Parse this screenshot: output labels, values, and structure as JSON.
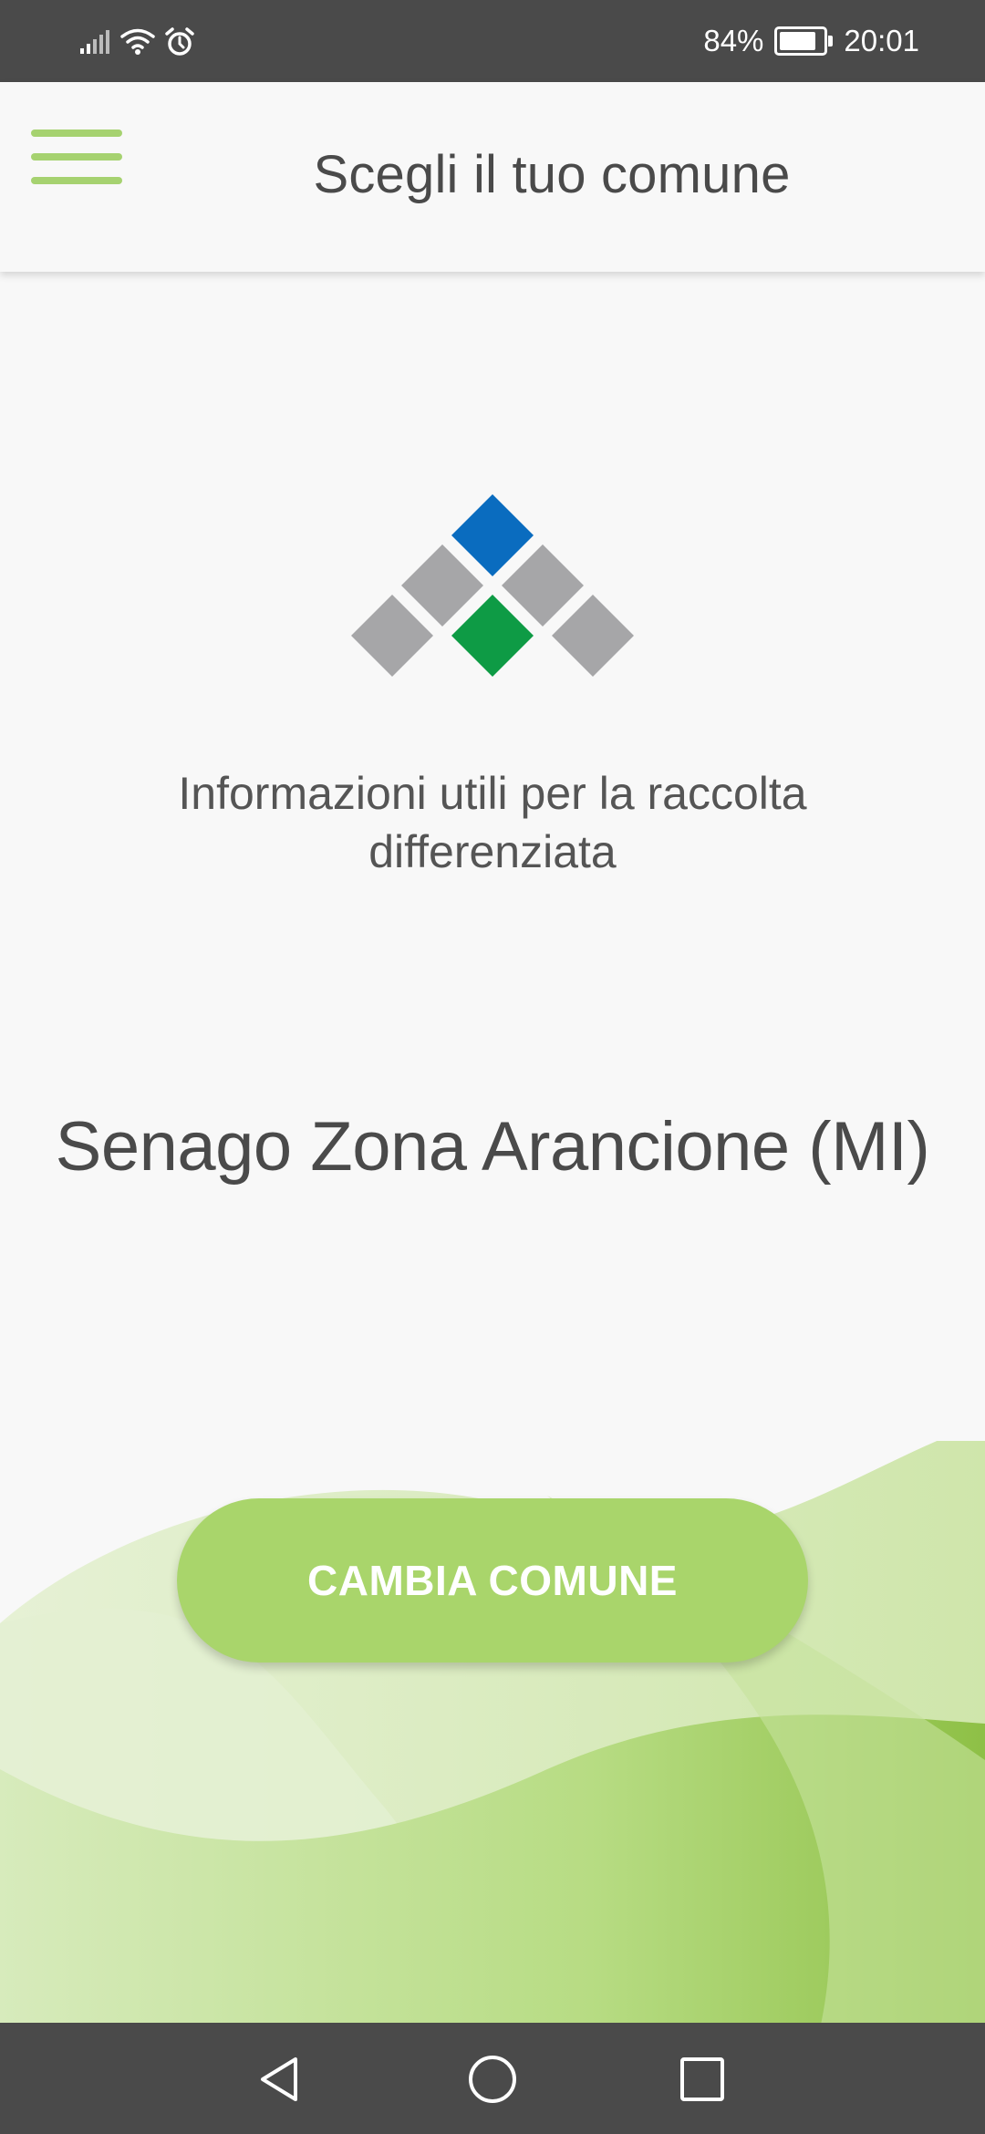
{
  "status_bar": {
    "battery_percent": "84%",
    "battery_level": 0.84,
    "time": "20:01",
    "icons": [
      "signal-icon",
      "wifi-icon",
      "alarm-icon",
      "battery-icon"
    ]
  },
  "app_bar": {
    "menu_icon": "menu-icon",
    "title": "Scegli il tuo comune"
  },
  "main": {
    "logo": "app-logo",
    "subtitle": "Informazioni utili per la raccolta differenziata",
    "comune_name": "Senago Zona Arancione (MI)",
    "change_button_label": "CAMBIA COMUNE"
  },
  "nav_bar": {
    "items": [
      "back-icon",
      "home-icon",
      "recents-icon"
    ]
  },
  "colors": {
    "accent_green": "#a9d56b",
    "dark_text": "#4a4a4a",
    "logo_blue": "#0a6cbf",
    "logo_green": "#0e9b45",
    "logo_gray": "#a6a6a8",
    "system_bar": "#4a4a4a"
  }
}
